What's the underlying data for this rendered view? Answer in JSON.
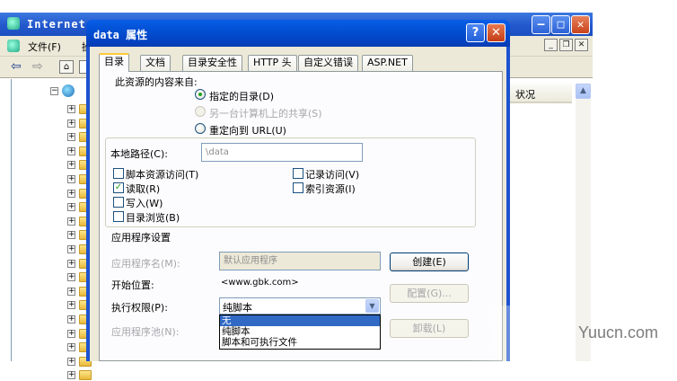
{
  "background_window": {
    "title": "Internet",
    "menu": {
      "file": "文件(F)",
      "next": "操"
    },
    "list_column": "状况"
  },
  "dialog": {
    "title": "data 属性",
    "tabs": [
      "目录",
      "文档",
      "目录安全性",
      "HTTP 头",
      "自定义错误",
      "ASP.NET"
    ],
    "content_source_label": "此资源的内容来自:",
    "radios": [
      {
        "label": "指定的目录(D)",
        "selected": true,
        "enabled": true
      },
      {
        "label": "另一台计算机上的共享(S)",
        "selected": false,
        "enabled": false
      },
      {
        "label": "重定向到 URL(U)",
        "selected": false,
        "enabled": true
      }
    ],
    "local_path": {
      "label": "本地路径(C):",
      "value": "\\data"
    },
    "checkboxes_left": [
      {
        "label": "脚本资源访问(T)",
        "checked": false
      },
      {
        "label": "读取(R)",
        "checked": true
      },
      {
        "label": "写入(W)",
        "checked": false
      },
      {
        "label": "目录浏览(B)",
        "checked": false
      }
    ],
    "checkboxes_right": [
      {
        "label": "记录访问(V)",
        "checked": false
      },
      {
        "label": "索引资源(I)",
        "checked": false
      }
    ],
    "app_settings": {
      "heading": "应用程序设置",
      "app_name_label": "应用程序名(M):",
      "app_name_value": "默认应用程序",
      "create_button": "创建(E)",
      "start_label": "开始位置:",
      "start_value": "<www.gbk.com>",
      "config_button": "配置(G)...",
      "exec_label": "执行权限(P):",
      "exec_value": "纯脚本",
      "exec_options": [
        "无",
        "纯脚本",
        "脚本和可执行文件"
      ],
      "exec_selected_index": 0,
      "pool_label": "应用程序池(N):",
      "unload_button": "卸载(L)"
    }
  },
  "watermark": "Yuucn.com"
}
